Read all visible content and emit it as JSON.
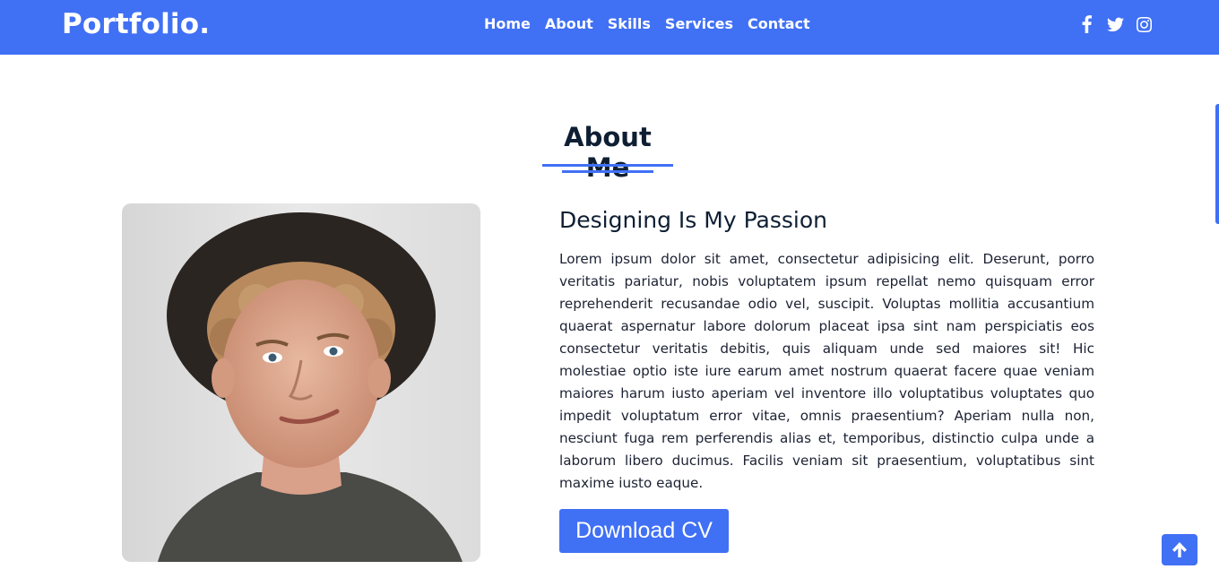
{
  "navbar": {
    "brand": "Portfolio.",
    "links": [
      "Home",
      "About",
      "Skills",
      "Services",
      "Contact"
    ],
    "socials": [
      "facebook-icon",
      "twitter-icon",
      "instagram-icon"
    ]
  },
  "about": {
    "title": "About Me",
    "subtitle": "Designing Is My Passion",
    "paragraph": "Lorem ipsum dolor sit amet, consectetur adipisicing elit. Deserunt, porro veritatis pariatur, nobis voluptatem ipsum repellat nemo quisquam error reprehenderit recusandae odio vel, suscipit. Voluptas mollitia accusantium quaerat aspernatur labore dolorum placeat ipsa sint nam perspiciatis eos consectetur veritatis debitis, quis aliquam unde sed maiores sit! Hic molestiae optio iste iure earum amet nostrum quaerat facere quae veniam maiores harum iusto aperiam vel inventore illo voluptatibus voluptates quo impedit voluptatum error vitae, omnis praesentium? Aperiam nulla non, nesciunt fuga rem perferendis alias et, temporibus, distinctio culpa unde a laborum libero ducimus. Facilis veniam sit praesentium, voluptatibus sint maxime iusto eaque.",
    "button": "Download CV"
  },
  "colors": {
    "accent": "#4070f4",
    "heading": "#0f1f33",
    "text": "#1c2233"
  },
  "scroll_top_icon": "arrow-up-icon"
}
